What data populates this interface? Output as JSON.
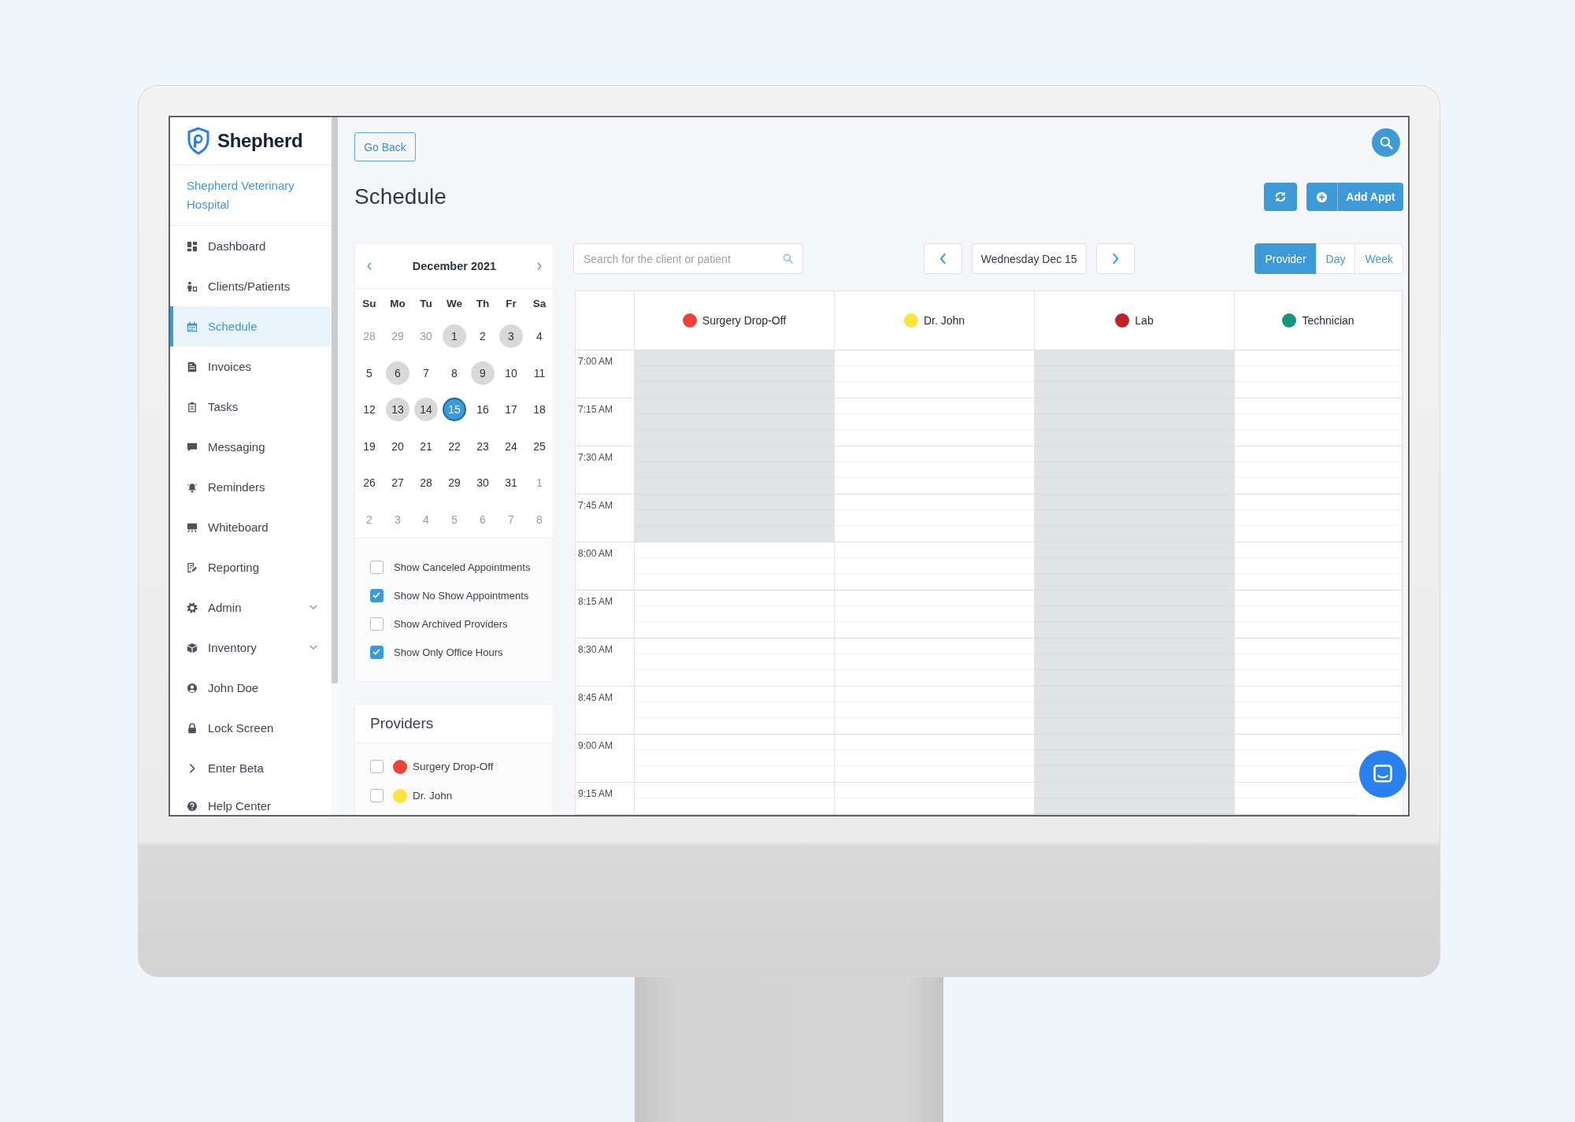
{
  "sidebar": {
    "brand": "Shepherd",
    "hospital": "Shepherd Veterinary Hospital",
    "items": [
      {
        "label": "Dashboard",
        "selected": false,
        "submenu": false
      },
      {
        "label": "Clients/Patients",
        "selected": false,
        "submenu": false
      },
      {
        "label": "Schedule",
        "selected": true,
        "submenu": false
      },
      {
        "label": "Invoices",
        "selected": false,
        "submenu": false
      },
      {
        "label": "Tasks",
        "selected": false,
        "submenu": false
      },
      {
        "label": "Messaging",
        "selected": false,
        "submenu": false
      },
      {
        "label": "Reminders",
        "selected": false,
        "submenu": false
      },
      {
        "label": "Whiteboard",
        "selected": false,
        "submenu": false
      },
      {
        "label": "Reporting",
        "selected": false,
        "submenu": false
      },
      {
        "label": "Admin",
        "selected": false,
        "submenu": true
      },
      {
        "label": "Inventory",
        "selected": false,
        "submenu": true
      },
      {
        "label": "John Doe",
        "selected": false,
        "submenu": false
      },
      {
        "label": "Lock Screen",
        "selected": false,
        "submenu": false
      },
      {
        "label": "Enter Beta",
        "selected": false,
        "submenu": false
      },
      {
        "label": "Help Center",
        "selected": false,
        "submenu": false
      }
    ]
  },
  "header": {
    "back_button": "Go Back",
    "title": "Schedule",
    "add_button": "Add Appt"
  },
  "mini_calendar": {
    "month": "December 2021",
    "weekdays": [
      "Su",
      "Mo",
      "Tu",
      "We",
      "Th",
      "Fr",
      "Sa"
    ],
    "weeks": [
      [
        {
          "day": "28",
          "other_month": true,
          "highlighted": false,
          "selected": false
        },
        {
          "day": "29",
          "other_month": true,
          "highlighted": false,
          "selected": false
        },
        {
          "day": "30",
          "other_month": true,
          "highlighted": false,
          "selected": false
        },
        {
          "day": "1",
          "other_month": false,
          "highlighted": true,
          "selected": false
        },
        {
          "day": "2",
          "other_month": false,
          "highlighted": false,
          "selected": false
        },
        {
          "day": "3",
          "other_month": false,
          "highlighted": true,
          "selected": false
        },
        {
          "day": "4",
          "other_month": false,
          "highlighted": false,
          "selected": false
        }
      ],
      [
        {
          "day": "5",
          "other_month": false,
          "highlighted": false,
          "selected": false
        },
        {
          "day": "6",
          "other_month": false,
          "highlighted": true,
          "selected": false
        },
        {
          "day": "7",
          "other_month": false,
          "highlighted": false,
          "selected": false
        },
        {
          "day": "8",
          "other_month": false,
          "highlighted": false,
          "selected": false
        },
        {
          "day": "9",
          "other_month": false,
          "highlighted": true,
          "selected": false
        },
        {
          "day": "10",
          "other_month": false,
          "highlighted": false,
          "selected": false
        },
        {
          "day": "11",
          "other_month": false,
          "highlighted": false,
          "selected": false
        }
      ],
      [
        {
          "day": "12",
          "other_month": false,
          "highlighted": false,
          "selected": false
        },
        {
          "day": "13",
          "other_month": false,
          "highlighted": true,
          "selected": false
        },
        {
          "day": "14",
          "other_month": false,
          "highlighted": true,
          "selected": false
        },
        {
          "day": "15",
          "other_month": false,
          "highlighted": false,
          "selected": true
        },
        {
          "day": "16",
          "other_month": false,
          "highlighted": false,
          "selected": false
        },
        {
          "day": "17",
          "other_month": false,
          "highlighted": false,
          "selected": false
        },
        {
          "day": "18",
          "other_month": false,
          "highlighted": false,
          "selected": false
        }
      ],
      [
        {
          "day": "19",
          "other_month": false,
          "highlighted": false,
          "selected": false
        },
        {
          "day": "20",
          "other_month": false,
          "highlighted": false,
          "selected": false
        },
        {
          "day": "21",
          "other_month": false,
          "highlighted": false,
          "selected": false
        },
        {
          "day": "22",
          "other_month": false,
          "highlighted": false,
          "selected": false
        },
        {
          "day": "23",
          "other_month": false,
          "highlighted": false,
          "selected": false
        },
        {
          "day": "24",
          "other_month": false,
          "highlighted": false,
          "selected": false
        },
        {
          "day": "25",
          "other_month": false,
          "highlighted": false,
          "selected": false
        }
      ],
      [
        {
          "day": "26",
          "other_month": false,
          "highlighted": false,
          "selected": false
        },
        {
          "day": "27",
          "other_month": false,
          "highlighted": false,
          "selected": false
        },
        {
          "day": "28",
          "other_month": false,
          "highlighted": false,
          "selected": false
        },
        {
          "day": "29",
          "other_month": false,
          "highlighted": false,
          "selected": false
        },
        {
          "day": "30",
          "other_month": false,
          "highlighted": false,
          "selected": false
        },
        {
          "day": "31",
          "other_month": false,
          "highlighted": false,
          "selected": false
        },
        {
          "day": "1",
          "other_month": true,
          "highlighted": false,
          "selected": false
        }
      ],
      [
        {
          "day": "2",
          "other_month": true,
          "highlighted": false,
          "selected": false
        },
        {
          "day": "3",
          "other_month": true,
          "highlighted": false,
          "selected": false
        },
        {
          "day": "4",
          "other_month": true,
          "highlighted": false,
          "selected": false
        },
        {
          "day": "5",
          "other_month": true,
          "highlighted": false,
          "selected": false
        },
        {
          "day": "6",
          "other_month": true,
          "highlighted": false,
          "selected": false
        },
        {
          "day": "7",
          "other_month": true,
          "highlighted": false,
          "selected": false
        },
        {
          "day": "8",
          "other_month": true,
          "highlighted": false,
          "selected": false
        }
      ]
    ]
  },
  "filters": [
    {
      "label": "Show Canceled Appointments",
      "checked": false
    },
    {
      "label": "Show No Show Appointments",
      "checked": true
    },
    {
      "label": "Show Archived Providers",
      "checked": false
    },
    {
      "label": "Show Only Office Hours",
      "checked": true
    }
  ],
  "providers_panel": {
    "title": "Providers",
    "items": [
      {
        "name": "Surgery Drop-Off",
        "color": "#f0413a",
        "checked": false
      },
      {
        "name": "Dr. John",
        "color": "#fde43a",
        "checked": false
      }
    ]
  },
  "toolbar": {
    "search": {
      "placeholder": "Search for the client or patient"
    },
    "date": "Wednesday Dec 15",
    "views": [
      {
        "label": "Provider",
        "selected": true
      },
      {
        "label": "Day",
        "selected": false
      },
      {
        "label": "Week",
        "selected": false
      }
    ]
  },
  "schedule": {
    "columns": [
      {
        "name": "Surgery Drop-Off",
        "color": "#f0413a"
      },
      {
        "name": "Dr. John",
        "color": "#fde43a"
      },
      {
        "name": "Lab",
        "color": "#c22026"
      },
      {
        "name": "Technician",
        "color": "#139781"
      }
    ],
    "rows": [
      {
        "time": "7:00 AM",
        "blocked": [
          true,
          false,
          true,
          false
        ]
      },
      {
        "time": "7:15 AM",
        "blocked": [
          true,
          false,
          true,
          false
        ]
      },
      {
        "time": "7:30 AM",
        "blocked": [
          true,
          false,
          true,
          false
        ]
      },
      {
        "time": "7:45 AM",
        "blocked": [
          true,
          false,
          true,
          false
        ]
      },
      {
        "time": "8:00 AM",
        "blocked": [
          false,
          false,
          true,
          false
        ]
      },
      {
        "time": "8:15 AM",
        "blocked": [
          false,
          false,
          true,
          false
        ]
      },
      {
        "time": "8:30 AM",
        "blocked": [
          false,
          false,
          true,
          false
        ]
      },
      {
        "time": "8:45 AM",
        "blocked": [
          false,
          false,
          true,
          false
        ]
      },
      {
        "time": "9:00 AM",
        "blocked": [
          false,
          false,
          true,
          false
        ]
      },
      {
        "time": "9:15 AM",
        "blocked": [
          false,
          false,
          true,
          false
        ]
      }
    ]
  }
}
